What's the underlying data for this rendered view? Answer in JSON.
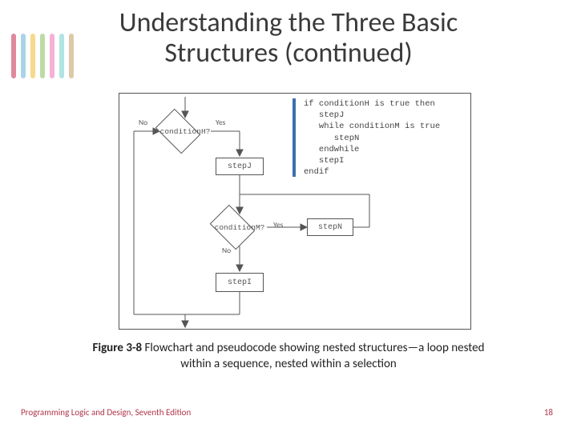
{
  "title_line1": "Understanding the Three Basic",
  "title_line2": "Structures (continued)",
  "stripes": [
    "#ca3b5a",
    "#6fb7d6",
    "#f0c23d",
    "#8fc56a",
    "#f07db8",
    "#7fd0d0",
    "#c7a56b"
  ],
  "pseudocode": "if conditionH is true then\n   stepJ\n   while conditionM is true\n      stepN\n   endwhile\n   stepI\nendif",
  "flow": {
    "condH": "conditionH?",
    "condM": "conditionM?",
    "stepJ": "stepJ",
    "stepI": "stepI",
    "stepN": "stepN",
    "no": "No",
    "yes": "Yes"
  },
  "caption_bold": "Figure 3-8",
  "caption_rest": " Flowchart and pseudocode showing nested structures—a loop nested within a sequence, nested within a selection",
  "footer_left": "Programming Logic and Design, Seventh Edition",
  "footer_right": "18"
}
